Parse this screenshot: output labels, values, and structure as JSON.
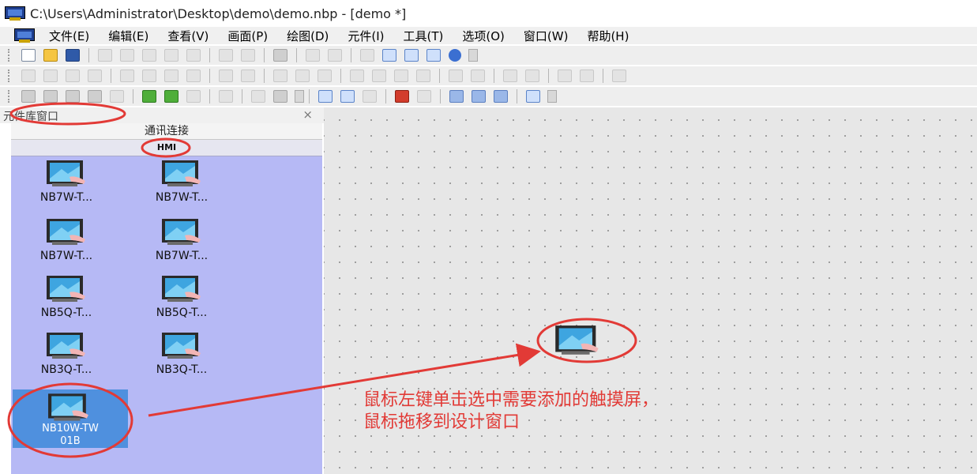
{
  "window": {
    "title": "C:\\Users\\Administrator\\Desktop\\demo\\demo.nbp - [demo *]"
  },
  "menu": [
    "文件(E)",
    "编辑(E)",
    "查看(V)",
    "画面(P)",
    "绘图(D)",
    "元件(I)",
    "工具(T)",
    "选项(O)",
    "窗口(W)",
    "帮助(H)"
  ],
  "library": {
    "title": "元件库窗口",
    "close": "×",
    "category": "通讯连接",
    "subcategory": "HMI",
    "components": [
      "NB7W-T...",
      "NB7W-T...",
      "NB7W-T...",
      "NB7W-T...",
      "NB5Q-T...",
      "NB5Q-T...",
      "NB3Q-T...",
      "NB3Q-T..."
    ],
    "selected": {
      "line1": "NB10W-TW",
      "line2": "01B"
    }
  },
  "annotation": {
    "line1": "鼠标左键单击选中需要添加的触摸屏，",
    "line2": "鼠标拖移到设计窗口"
  },
  "colors": {
    "annotation": "#e23a36",
    "panel": "#b6b9f5",
    "selected": "#4f90de"
  }
}
